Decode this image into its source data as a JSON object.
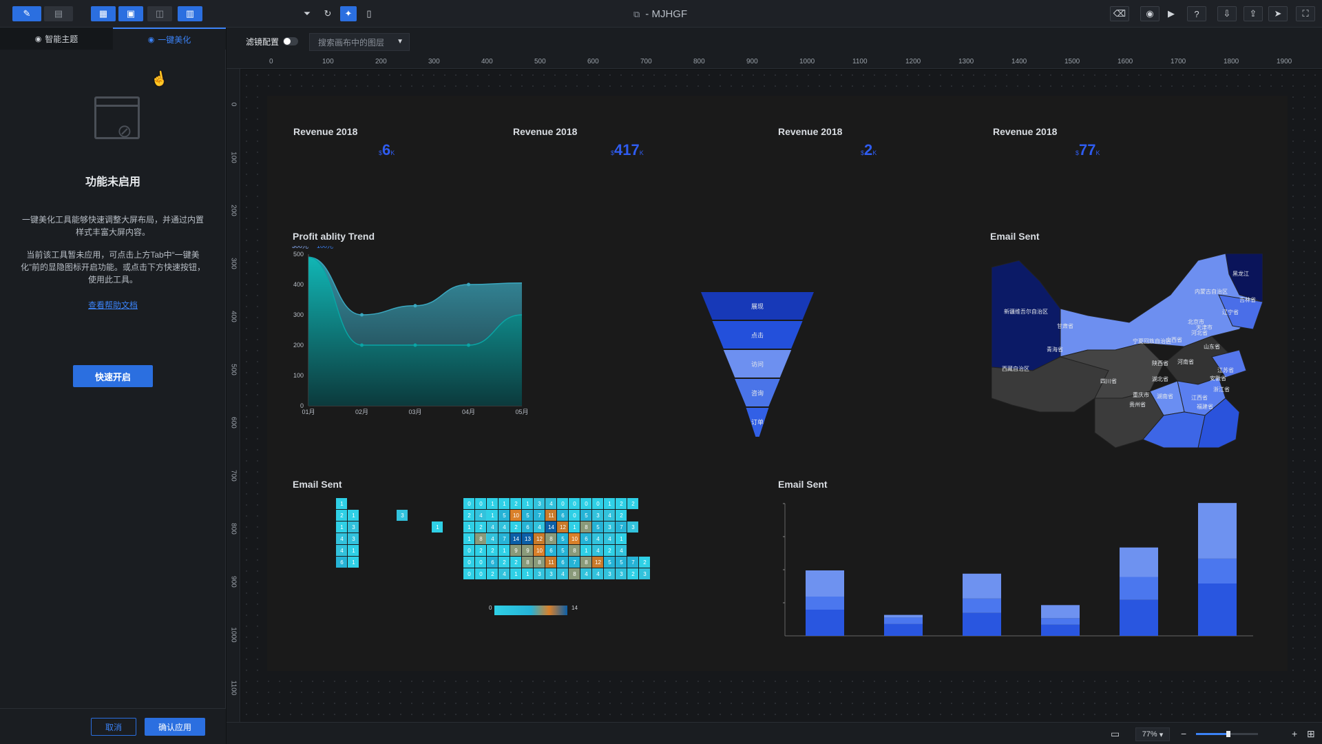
{
  "app": {
    "title": "- MJHGF",
    "file_icon": "copy-icon"
  },
  "toolbar_left": [
    {
      "icon": "edit-icon",
      "glyph": "✎",
      "active": true
    },
    {
      "icon": "preview-icon",
      "glyph": "▤",
      "active": false
    },
    {
      "icon": "layout-a-icon",
      "glyph": "▦",
      "active": true
    },
    {
      "icon": "layout-b-icon",
      "glyph": "▣",
      "active": true
    },
    {
      "icon": "layout-c-icon",
      "glyph": "◫",
      "active": false
    },
    {
      "icon": "layout-d-icon",
      "glyph": "▥",
      "active": true
    }
  ],
  "toolbar_mid": [
    {
      "icon": "filter-icon",
      "glyph": "⏷",
      "active": false
    },
    {
      "icon": "refresh-icon",
      "glyph": "↻",
      "active": false
    },
    {
      "icon": "beautify-icon",
      "glyph": "✦",
      "active": true
    },
    {
      "icon": "device-icon",
      "glyph": "▯",
      "active": false
    }
  ],
  "toolbar_right": [
    {
      "icon": "clear-icon",
      "glyph": "⌫"
    },
    {
      "icon": "camera-icon",
      "glyph": "◉"
    },
    {
      "icon": "play-icon",
      "glyph": "▶"
    },
    {
      "icon": "help-icon",
      "glyph": "?"
    },
    {
      "icon": "download-icon",
      "glyph": "⇩"
    },
    {
      "icon": "export-icon",
      "glyph": "⇪"
    },
    {
      "icon": "publish-icon",
      "glyph": "➤"
    },
    {
      "icon": "fullscreen-icon",
      "glyph": "⛶"
    }
  ],
  "sidebar": {
    "tab_theme": "智能主题",
    "tab_beautify": "一键美化",
    "heading": "功能未启用",
    "desc1": "一键美化工具能够快速调整大屏布局，并通过内置样式丰富大屏内容。",
    "desc2": "当前该工具暂未应用，可点击上方Tab中“一键美化”前的显隐图标开启功能。或点击下方快速按钮，使用此工具。",
    "help_link": "查看帮助文档",
    "quick_start": "快速开启",
    "cancel": "取消",
    "confirm": "确认应用"
  },
  "filterbar": {
    "label": "滤镜配置",
    "search_placeholder": "搜索画布中的图层"
  },
  "ruler": {
    "h_ticks": [
      "0",
      "100",
      "200",
      "300",
      "400",
      "500",
      "600",
      "700",
      "800",
      "900",
      "1000",
      "1100",
      "1200",
      "1300",
      "1400",
      "1500",
      "1600",
      "1700",
      "1800",
      "1900"
    ],
    "v_ticks": [
      "0",
      "100",
      "200",
      "300",
      "400",
      "500",
      "600",
      "700",
      "800",
      "900",
      "1000",
      "1100"
    ]
  },
  "kpis": [
    {
      "title": "Revenue 2018",
      "prefix": "$",
      "value": "6",
      "suffix": "K"
    },
    {
      "title": "Revenue 2018",
      "prefix": "$",
      "value": "417",
      "suffix": "K"
    },
    {
      "title": "Revenue 2018",
      "prefix": "$",
      "value": "2",
      "suffix": "K"
    },
    {
      "title": "Revenue 2018",
      "prefix": "$",
      "value": "77",
      "suffix": "K"
    }
  ],
  "panels": {
    "profit_title": "Profit ablity Trend",
    "map_title": "Email Sent",
    "heatmap_title": "Email Sent",
    "bars_title": "Email Sent"
  },
  "chart_data": [
    {
      "type": "area",
      "title": "Profit ablity Trend",
      "categories": [
        "01月",
        "02月",
        "03月",
        "04月",
        "05月"
      ],
      "ylim": [
        0,
        500
      ],
      "yticks": [
        0,
        100,
        200,
        300,
        400,
        500
      ],
      "legend": [
        "300元",
        "100元"
      ],
      "series": [
        {
          "name": "300元",
          "values": [
            490,
            300,
            330,
            400,
            405
          ],
          "color": "#3aa8c0"
        },
        {
          "name": "100元",
          "values": [
            490,
            200,
            200,
            200,
            300
          ],
          "color": "#0aa5a5"
        }
      ]
    },
    {
      "type": "funnel",
      "categories": [
        "展现",
        "点击",
        "访问",
        "咨询",
        "订单"
      ],
      "colors": [
        "#1739b8",
        "#2350db",
        "#6d90f0",
        "#4a74e8",
        "#3260e6"
      ]
    },
    {
      "type": "heatmap",
      "range": [
        0,
        14
      ],
      "min_label": "0",
      "max_label": "14"
    },
    {
      "type": "bar",
      "stacked": true,
      "series": [
        {
          "values": [
            40,
            18,
            35,
            17,
            55,
            80
          ],
          "color": "#2956e0"
        },
        {
          "values": [
            20,
            10,
            22,
            10,
            35,
            38
          ],
          "color": "#4b77ee"
        },
        {
          "values": [
            40,
            4,
            38,
            20,
            45,
            85
          ],
          "color": "#6e92f0"
        }
      ]
    }
  ],
  "map": {
    "labels": [
      "黑龙江",
      "内蒙古自治区",
      "吉林省",
      "辽宁省",
      "甘肃省",
      "北京市",
      "天津市",
      "河北省",
      "山西省",
      "新疆维吾尔自治区",
      "青海省",
      "宁夏回族自治区",
      "山东省",
      "陕西省",
      "河南省",
      "西藏自治区",
      "四川省",
      "湖北省",
      "江苏省",
      "安徽省",
      "浙江省",
      "重庆市",
      "湖南省",
      "江西省",
      "贵州省",
      "福建省"
    ]
  },
  "status": {
    "zoom": "77%",
    "zoom_fraction": 0.77
  }
}
